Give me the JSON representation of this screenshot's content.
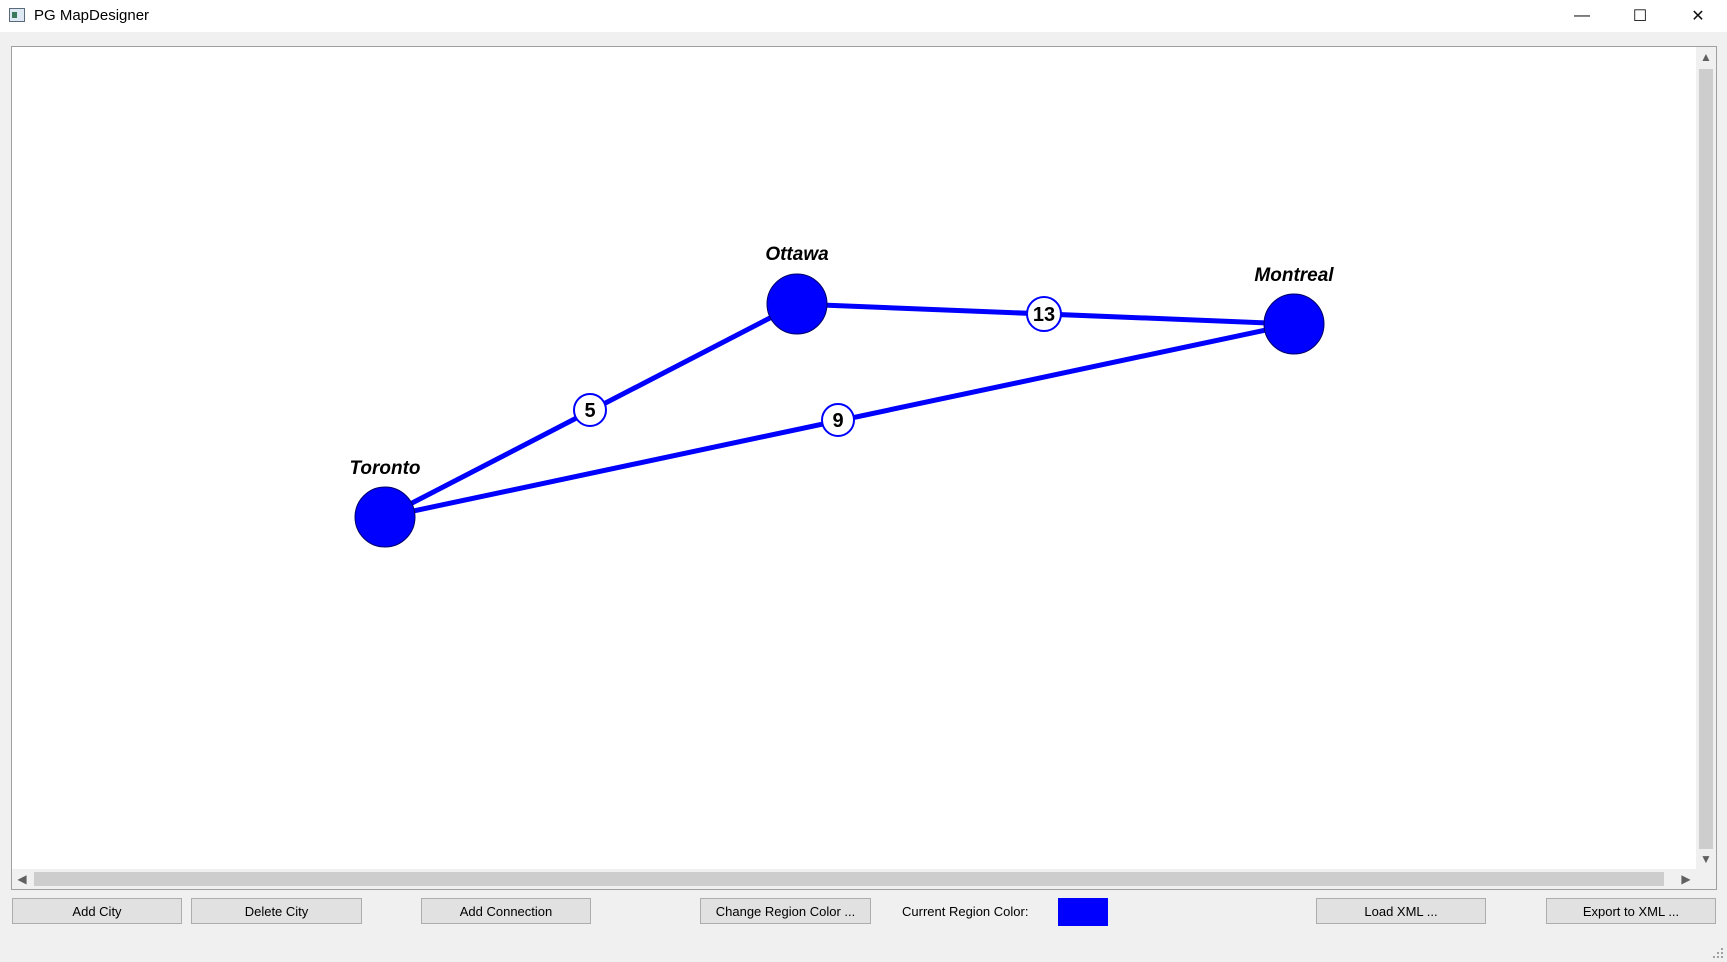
{
  "window": {
    "title": "PG MapDesigner",
    "controls": {
      "minimize": "—",
      "maximize": "☐",
      "close": "✕"
    }
  },
  "map": {
    "accent_color": "#0000ff",
    "cities": [
      {
        "name": "Toronto"
      },
      {
        "name": "Ottawa"
      },
      {
        "name": "Montreal"
      }
    ],
    "connections": [
      {
        "from": "Toronto",
        "to": "Ottawa",
        "weight": "5"
      },
      {
        "from": "Ottawa",
        "to": "Montreal",
        "weight": "13"
      },
      {
        "from": "Toronto",
        "to": "Montreal",
        "weight": "9"
      }
    ]
  },
  "toolbar": {
    "add_city": "Add City",
    "delete_city": "Delete City",
    "add_connection": "Add Connection",
    "change_region_color": "Change Region Color ...",
    "current_region_color_label": "Current Region Color:",
    "current_region_color": "#0000ff",
    "load_xml": "Load XML ...",
    "export_xml": "Export to XML ..."
  }
}
